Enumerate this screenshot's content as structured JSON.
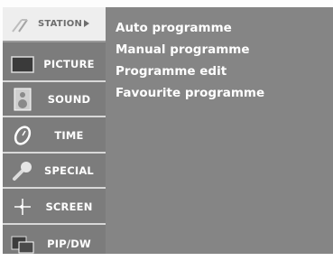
{
  "sidebar": {
    "items": [
      {
        "label": "STATION",
        "icon": "station-icon",
        "selected": true
      },
      {
        "label": "PICTURE",
        "icon": "picture-icon",
        "selected": false
      },
      {
        "label": "SOUND",
        "icon": "speaker-icon",
        "selected": false
      },
      {
        "label": "TIME",
        "icon": "clock-icon",
        "selected": false
      },
      {
        "label": "SPECIAL",
        "icon": "special-icon",
        "selected": false
      },
      {
        "label": "SCREEN",
        "icon": "screen-cross-icon",
        "selected": false
      },
      {
        "label": "PIP/DW",
        "icon": "pip-icon",
        "selected": false
      }
    ]
  },
  "submenu": {
    "items": [
      {
        "label": "Auto programme"
      },
      {
        "label": "Manual programme"
      },
      {
        "label": "Programme edit"
      },
      {
        "label": "Favourite programme"
      }
    ]
  },
  "colors": {
    "sidebar_bg": "#7c7c7c",
    "submenu_bg": "#858585",
    "selected_bg": "#eeeeee",
    "text": "#ffffff"
  }
}
